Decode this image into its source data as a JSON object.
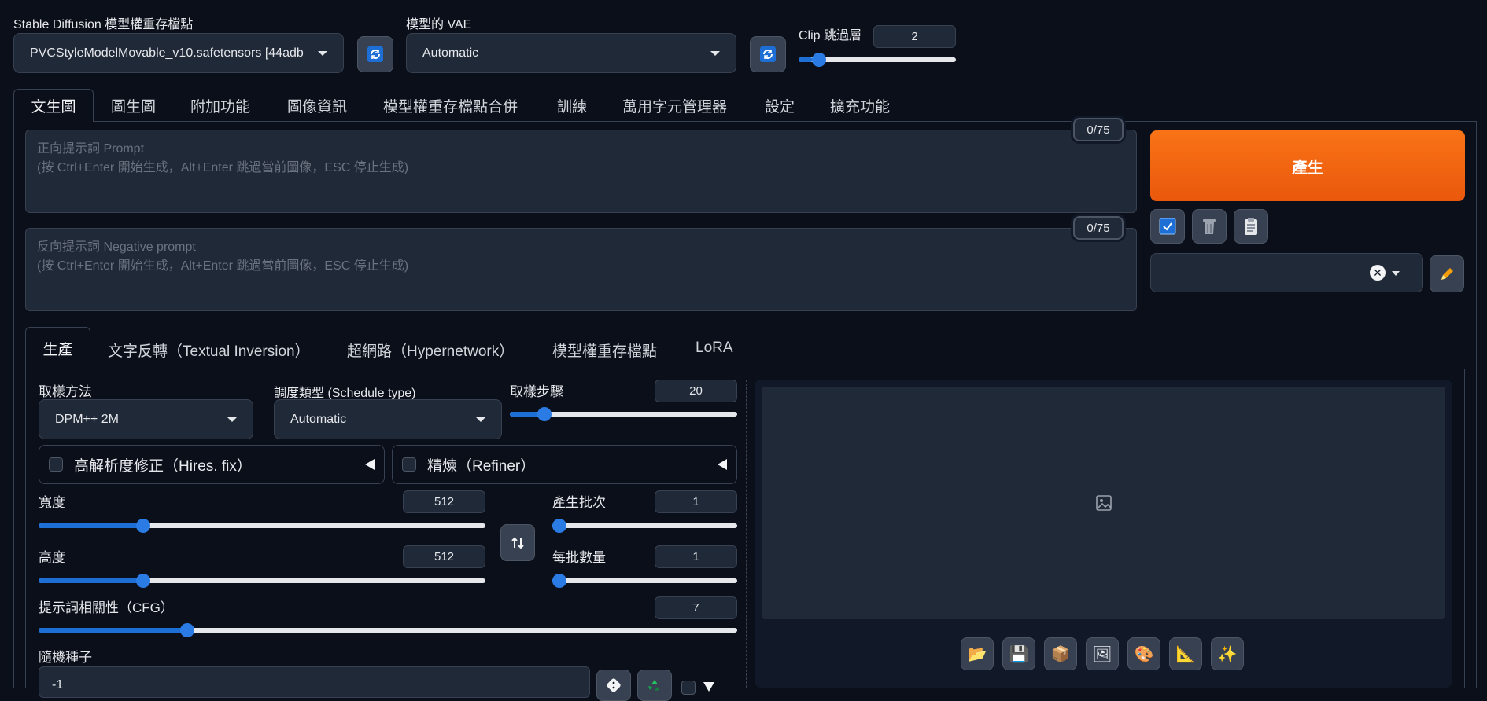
{
  "header": {
    "checkpoint_label": "Stable Diffusion 模型權重存檔點",
    "checkpoint_value": "PVCStyleModelMovable_v10.safetensors [44adb",
    "vae_label": "模型的 VAE",
    "vae_value": "Automatic",
    "clip_label": "Clip 跳過層",
    "clip_value": "2",
    "clip_slider": {
      "value": 2,
      "min": 1,
      "max": 12
    }
  },
  "main_tabs": [
    "文生圖",
    "圖生圖",
    "附加功能",
    "圖像資訊",
    "模型權重存檔點合併",
    "訓練",
    "萬用字元管理器",
    "設定",
    "擴充功能"
  ],
  "prompt": {
    "placeholder_line1": "正向提示詞 Prompt",
    "placeholder_line2": "(按 Ctrl+Enter 開始生成，Alt+Enter 跳過當前圖像，ESC 停止生成)",
    "counter": "0/75"
  },
  "negative_prompt": {
    "placeholder_line1": "反向提示詞 Negative prompt",
    "placeholder_line2": "(按 Ctrl+Enter 開始生成，Alt+Enter 跳過當前圖像，ESC 停止生成)",
    "counter": "0/75"
  },
  "generate_label": "產生",
  "sub_tabs": [
    "生產",
    "文字反轉（Textual Inversion）",
    "超網路（Hypernetwork）",
    "模型權重存檔點",
    "LoRA"
  ],
  "params": {
    "sampler_label": "取樣方法",
    "sampler_value": "DPM++ 2M",
    "schedule_label": "調度類型 (Schedule type)",
    "schedule_value": "Automatic",
    "steps_label": "取樣步驟",
    "steps_value": "20",
    "hires_label": "高解析度修正（Hires. fix）",
    "refiner_label": "精煉（Refiner）",
    "width_label": "寬度",
    "width_value": "512",
    "height_label": "高度",
    "height_value": "512",
    "batch_count_label": "產生批次",
    "batch_count_value": "1",
    "batch_size_label": "每批數量",
    "batch_size_value": "1",
    "cfg_label": "提示詞相關性（CFG）",
    "cfg_value": "7",
    "seed_label": "隨機種子",
    "seed_value": "-1"
  },
  "sliders": {
    "steps": {
      "value": 20,
      "min": 1,
      "max": 150
    },
    "width": {
      "value": 512,
      "min": 64,
      "max": 2048
    },
    "height": {
      "value": 512,
      "min": 64,
      "max": 2048
    },
    "batch_count": {
      "value": 1,
      "min": 1,
      "max": 100
    },
    "batch_size": {
      "value": 1,
      "min": 1,
      "max": 8
    },
    "cfg": {
      "value": 7,
      "min": 1,
      "max": 30
    }
  },
  "colors": {
    "accent": "#1d6fd6",
    "generate_start": "#f97316",
    "generate_end": "#ea580c",
    "background": "#0b0f19"
  }
}
